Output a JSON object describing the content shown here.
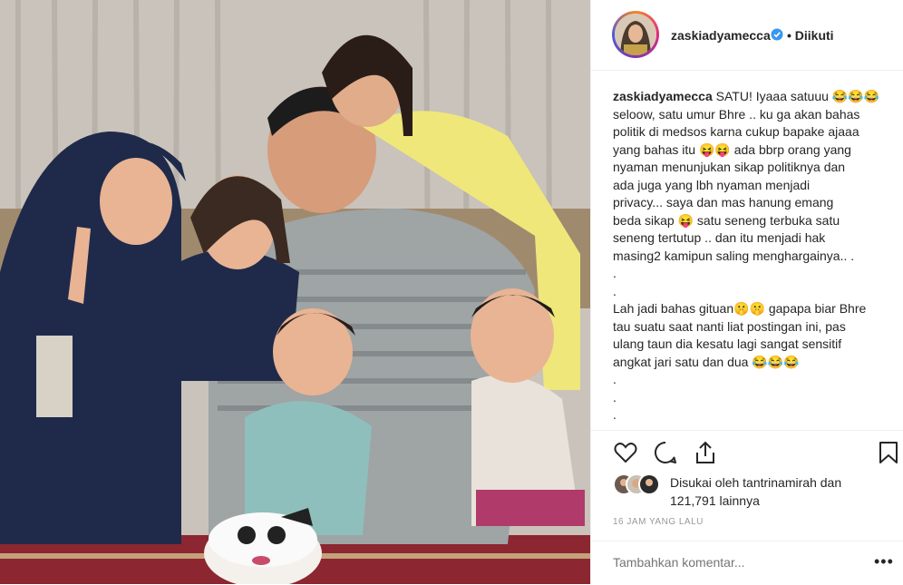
{
  "post": {
    "username": "zaskiadyamecca",
    "follow_status": "• Diikuti",
    "caption_lines": [
      "SATU! Iyaaa satuuu 😂😂😂",
      "seloow, satu umur Bhre .. ku ga akan bahas",
      "politik di medsos karna cukup bapake ajaaa",
      "yang bahas itu 😝😝 ada bbrp orang yang",
      "nyaman menunjukan sikap politiknya dan",
      "ada juga yang lbh nyaman menjadi",
      "privacy... saya dan mas hanung emang",
      "beda sikap 😝 satu seneng terbuka satu",
      "seneng tertutup .. dan itu menjadi hak",
      "masing2 kamipun saling menghargainya.. .",
      ".",
      ".",
      "Lah jadi bahas gituan🤫🤫 gapapa biar Bhre",
      "tau suatu saat nanti liat postingan ini, pas",
      "ulang taun dia kesatu lagi sangat sensitif",
      "angkat jari satu dan dua 😂😂😂",
      ".",
      ".",
      "."
    ],
    "likes_line1": "Disukai oleh tantrinamirah dan",
    "likes_line2": "121,791 lainnya",
    "timestamp": "16 JAM YANG LALU",
    "comment_placeholder": "Tambahkan komentar...",
    "more_label": "•••",
    "icons": [
      "heart-icon",
      "comment-icon",
      "share-icon",
      "bookmark-icon",
      "verified-badge-icon"
    ],
    "accent_colors": {
      "verified": "#3897f0",
      "text": "#262626",
      "muted": "#999999"
    }
  }
}
